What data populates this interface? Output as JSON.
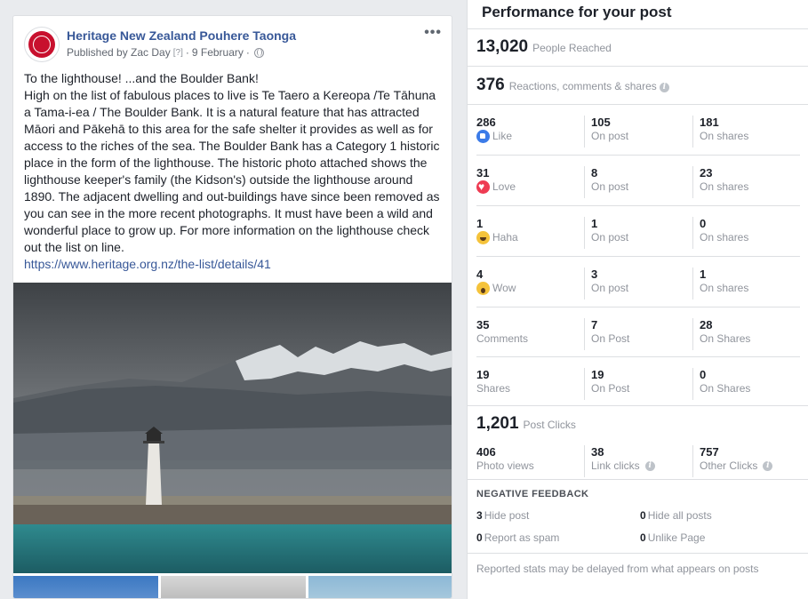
{
  "post": {
    "page_name": "Heritage New Zealand Pouhere Taonga",
    "published_by": "Published by Zac Day",
    "help_mark": "[?]",
    "separator": "·",
    "date": "9 February",
    "more_label": "•••",
    "text_line1": "To the lighthouse! ...and the Boulder Bank!",
    "text_body": "High on the list of fabulous places to live is Te Taero a Kereopa /Te Tāhuna a Tama-i-ea / The Boulder Bank. It is a natural feature that has attracted Māori and Pākehā to this area for the safe shelter it provides as well as for access to the riches of the sea. The Boulder Bank has a Category 1 historic place in the form of the lighthouse. The historic photo attached shows the lighthouse keeper's family (the Kidson's) outside the lighthouse around 1890. The adjacent dwelling and out-buildings have since been removed as you can see in the more recent photographs. It must have been a wild and wonderful place to grow up. For more information on the lighthouse check out the list on line.",
    "link": "https://www.heritage.org.nz/the-list/details/41"
  },
  "panel": {
    "title": "Performance for your post",
    "reached": {
      "value": "13,020",
      "label": "People Reached"
    },
    "reactions_total": {
      "value": "376",
      "label": "Reactions, comments & shares"
    },
    "rows": [
      {
        "total": "286",
        "label": "Like",
        "icon": "like-icon",
        "on_post": "105",
        "on_post_label": "On post",
        "on_shares": "181",
        "on_shares_label": "On shares"
      },
      {
        "total": "31",
        "label": "Love",
        "icon": "love-icon",
        "on_post": "8",
        "on_post_label": "On post",
        "on_shares": "23",
        "on_shares_label": "On shares"
      },
      {
        "total": "1",
        "label": "Haha",
        "icon": "haha-icon",
        "on_post": "1",
        "on_post_label": "On post",
        "on_shares": "0",
        "on_shares_label": "On shares"
      },
      {
        "total": "4",
        "label": "Wow",
        "icon": "wow-icon",
        "on_post": "3",
        "on_post_label": "On post",
        "on_shares": "1",
        "on_shares_label": "On shares"
      },
      {
        "total": "35",
        "label": "Comments",
        "on_post": "7",
        "on_post_label": "On Post",
        "on_shares": "28",
        "on_shares_label": "On Shares"
      },
      {
        "total": "19",
        "label": "Shares",
        "on_post": "19",
        "on_post_label": "On Post",
        "on_shares": "0",
        "on_shares_label": "On Shares"
      }
    ],
    "clicks": {
      "value": "1,201",
      "label": "Post Clicks"
    },
    "click_breakdown": [
      {
        "value": "406",
        "label": "Photo views"
      },
      {
        "value": "38",
        "label": "Link clicks"
      },
      {
        "value": "757",
        "label": "Other Clicks"
      }
    ],
    "negative": {
      "title": "NEGATIVE FEEDBACK",
      "hide_post": {
        "value": "3",
        "label": "Hide post"
      },
      "hide_all": {
        "value": "0",
        "label": "Hide all posts"
      },
      "spam": {
        "value": "0",
        "label": "Report as spam"
      },
      "unlike": {
        "value": "0",
        "label": "Unlike Page"
      }
    },
    "footnote": "Reported stats may be delayed from what appears on posts"
  },
  "colors": {
    "link": "#385898",
    "like": "#3b7be8",
    "love": "#ee3b52",
    "emoji": "#f5c33b"
  }
}
